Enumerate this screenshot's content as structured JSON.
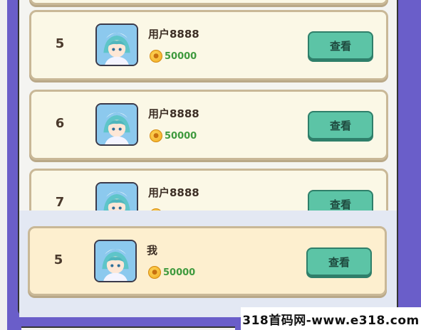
{
  "leaderboard": {
    "rows": [
      {
        "rank": "",
        "name": "",
        "score": "",
        "action": ""
      },
      {
        "rank": "5",
        "name": "用户8888",
        "score": "50000",
        "action": "查看"
      },
      {
        "rank": "6",
        "name": "用户8888",
        "score": "50000",
        "action": "查看"
      },
      {
        "rank": "7",
        "name": "用户8888",
        "score": "",
        "action": "查看"
      }
    ],
    "me": {
      "rank": "5",
      "name": "我",
      "score": "50000",
      "action": "查看"
    }
  },
  "watermark": "318首码网-www.e318.com",
  "colors": {
    "background": "#6a5ec9",
    "card": "#fbf8e6",
    "my_card": "#fdefcf",
    "button": "#5cc4a6",
    "score": "#3f9a3e"
  },
  "icons": {
    "coin": "coin-icon",
    "avatar": "avatar-image"
  }
}
